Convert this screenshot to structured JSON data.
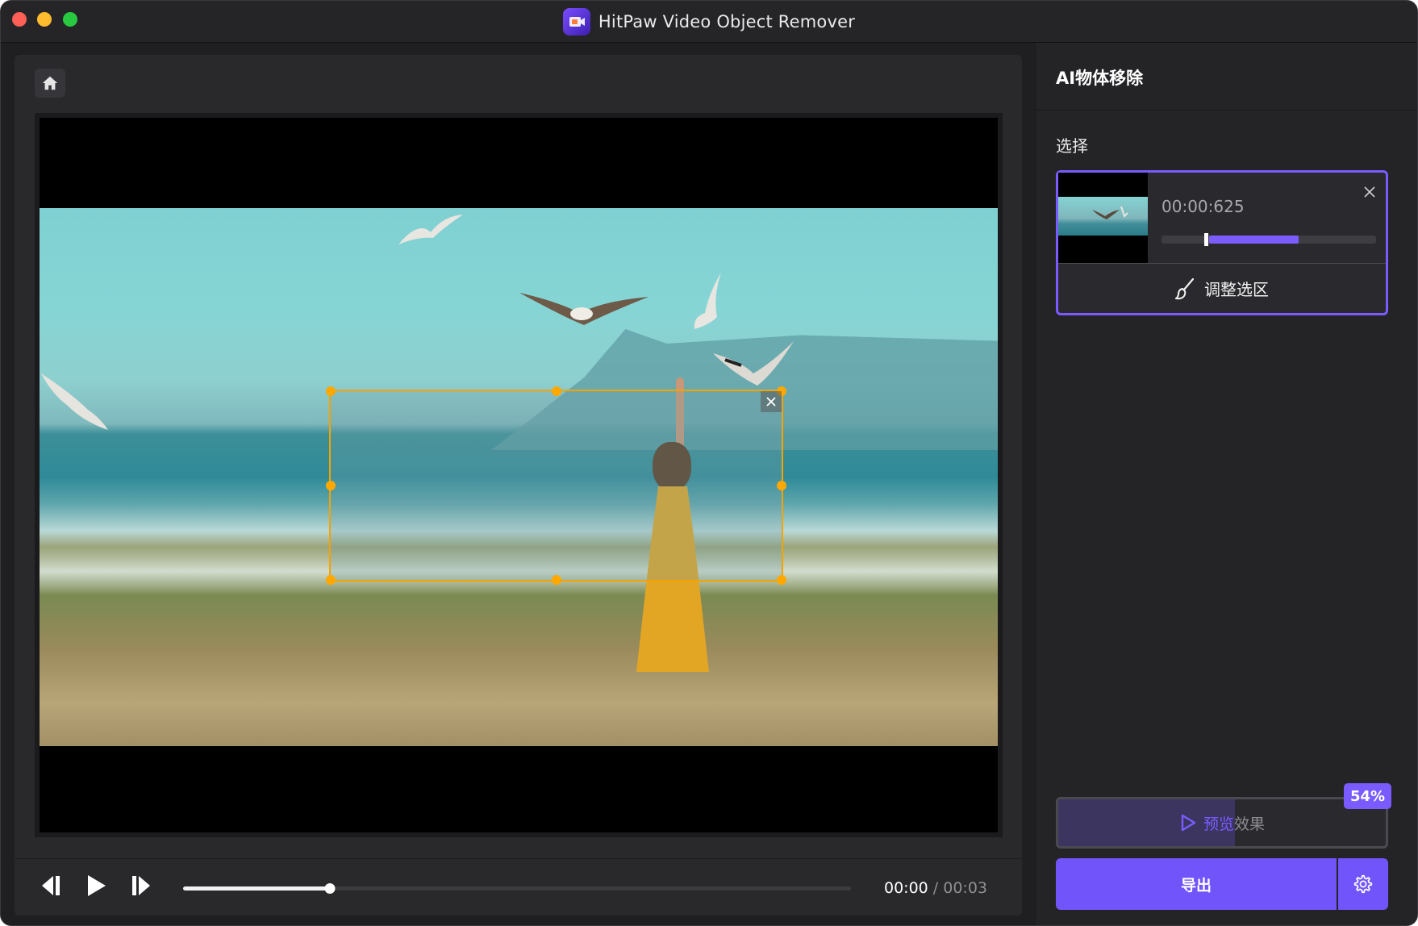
{
  "window": {
    "title": "HitPaw Video Object Remover"
  },
  "player": {
    "current_time": "00:00",
    "separator": " / ",
    "total_time": "00:03",
    "progress": 0.22
  },
  "sidebar": {
    "title": "AI物体移除",
    "section_label": "选择",
    "selection_card": {
      "timestamp": "00:00:625",
      "range_start": 0.22,
      "range_end": 0.64,
      "cursor_position": 0.2,
      "adjust_label": "调整选区"
    },
    "preview": {
      "label_highlight": "预览",
      "label_rest": "效果",
      "progress_text": "54%",
      "progress": 0.54
    },
    "export_label": "导出"
  },
  "icons": {
    "home": "home-icon",
    "play": "play-icon",
    "prev_frame": "previous-frame-icon",
    "next_frame": "next-frame-icon",
    "close": "close-icon",
    "brush": "brush-icon",
    "settings": "gear-icon"
  },
  "colors": {
    "accent": "#7255fa",
    "selection_border": "#f4a300",
    "background": "#1f1f22"
  }
}
